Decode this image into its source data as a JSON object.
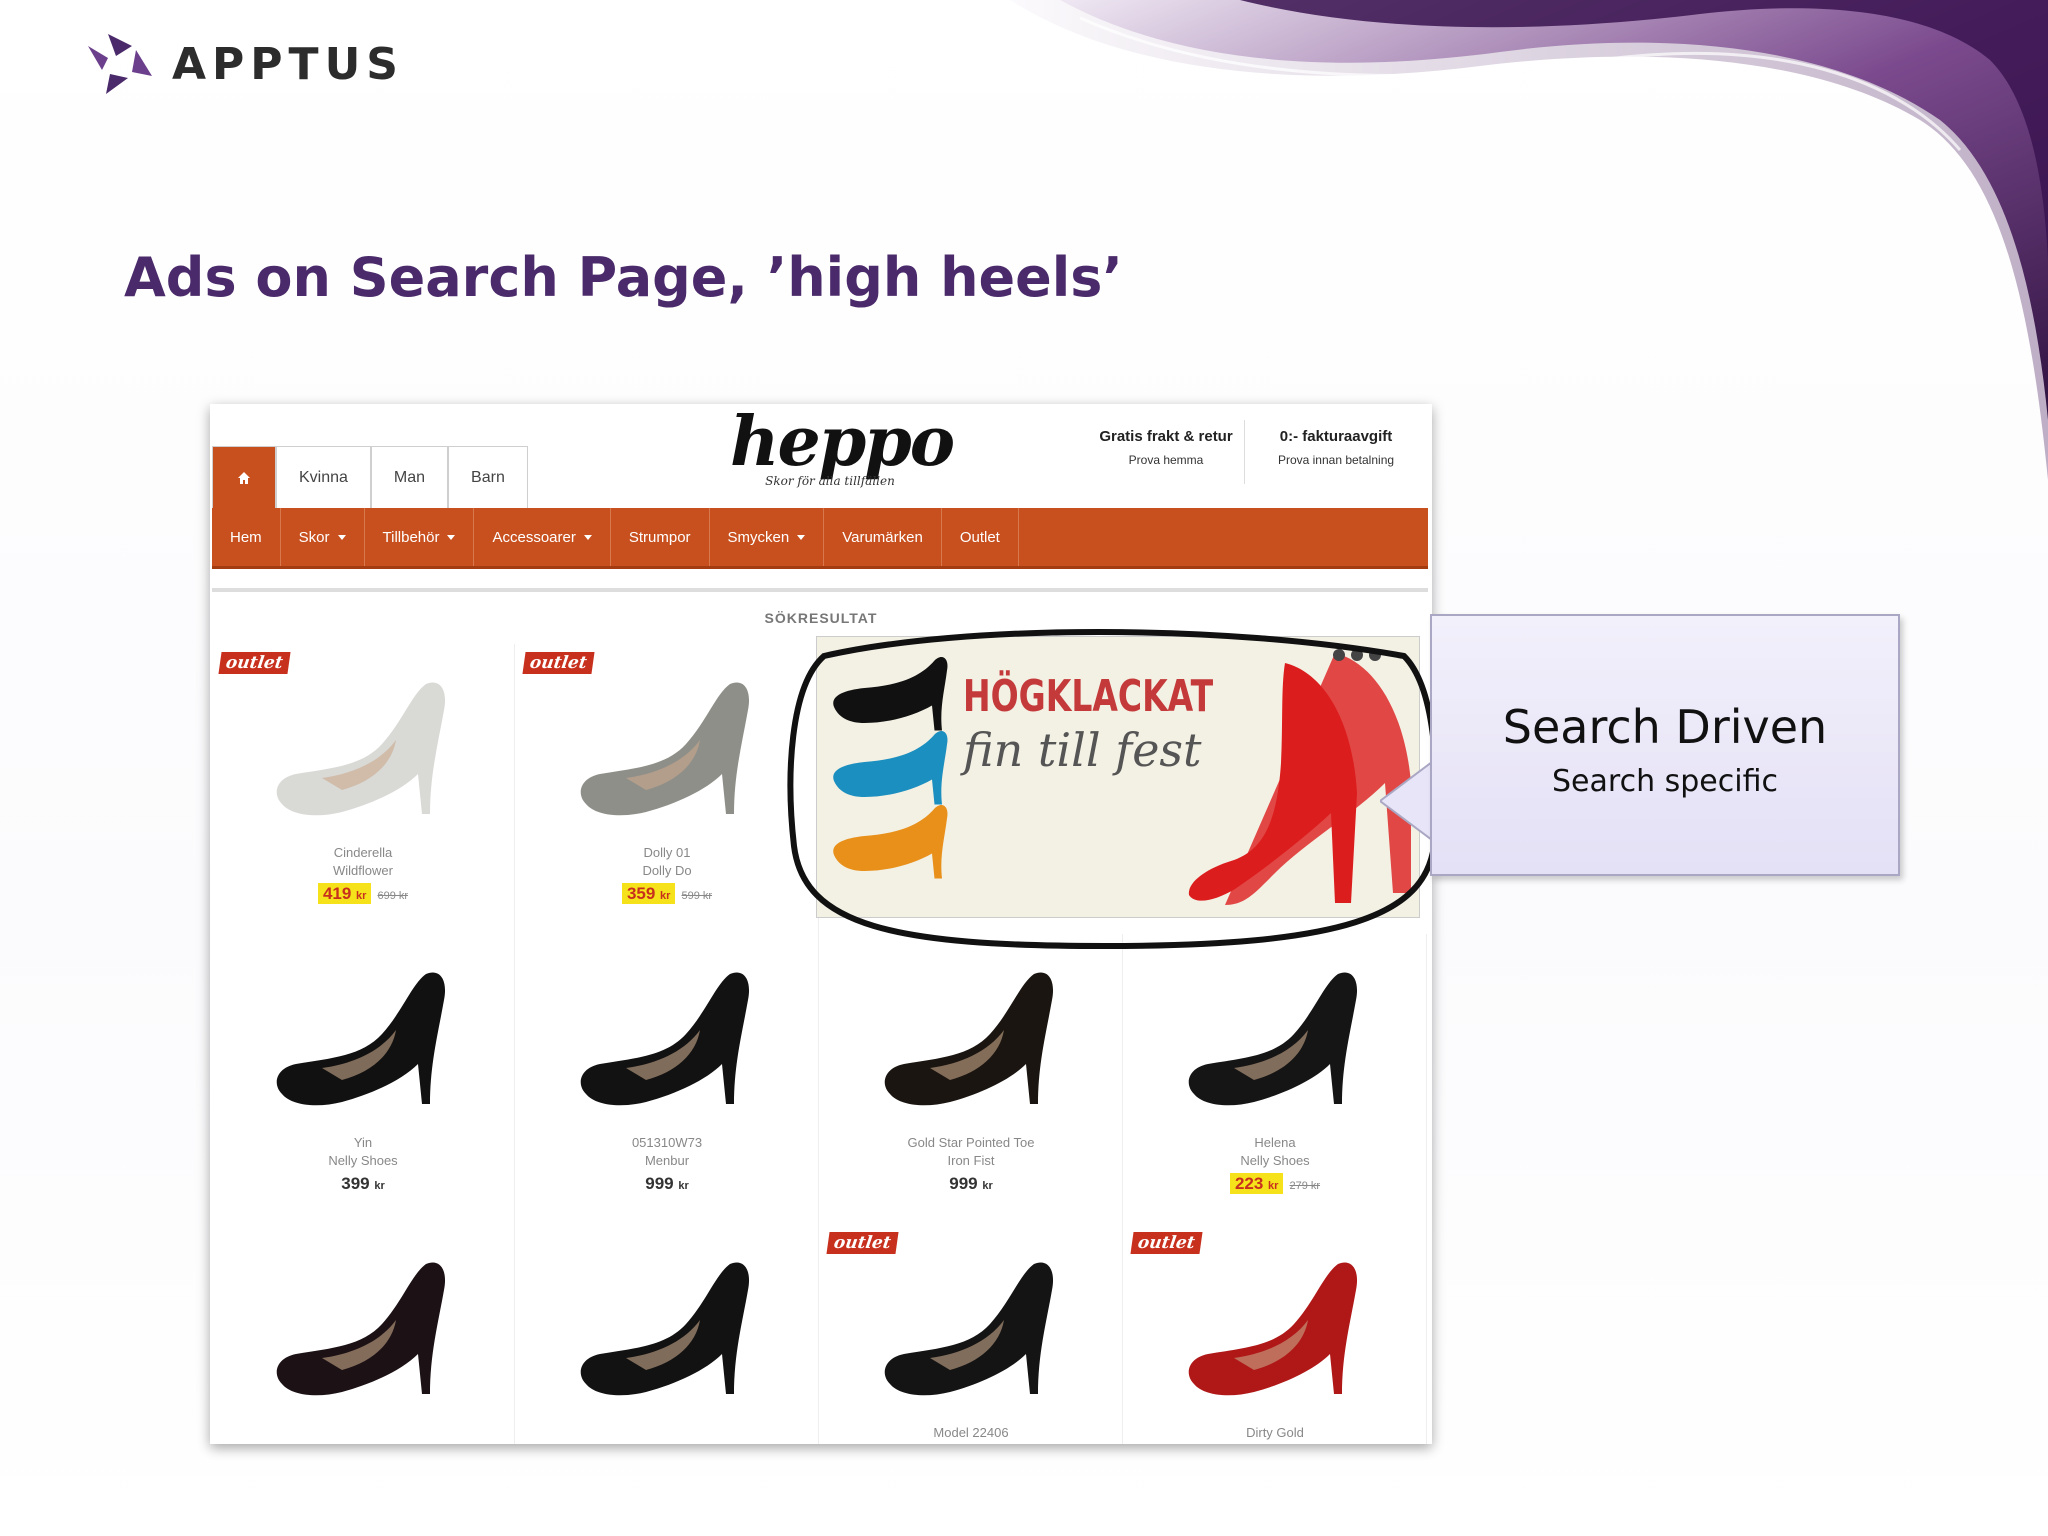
{
  "colors": {
    "title": "#4a2a6a",
    "brand_orange": "#c8501e",
    "price_highlight": "#f6e21a",
    "outlet_red": "#c8301e",
    "callout_bg": "#e8e5f8"
  },
  "logo": {
    "text": "APPTUS",
    "icon": "apptus-triangle-logo"
  },
  "slide": {
    "title": "Ads on Search Page, ’high heels’"
  },
  "store": {
    "brand": "heppo",
    "tagline": "Skor för alla tillfällen",
    "home_icon": "home-icon",
    "top_tabs": [
      "Kvinna",
      "Man",
      "Barn"
    ],
    "promos": [
      {
        "title": "Gratis frakt & retur",
        "sub": "Prova hemma"
      },
      {
        "title": "0:- fakturaavgift",
        "sub": "Prova innan betalning"
      }
    ],
    "nav": [
      {
        "label": "Hem",
        "caret": false
      },
      {
        "label": "Skor",
        "caret": true
      },
      {
        "label": "Tillbehör",
        "caret": true
      },
      {
        "label": "Accessoarer",
        "caret": true
      },
      {
        "label": "Strumpor",
        "caret": false
      },
      {
        "label": "Smycken",
        "caret": true
      },
      {
        "label": "Varumärken",
        "caret": false
      },
      {
        "label": "Outlet",
        "caret": false
      }
    ],
    "results_label": "SÖKRESULTAT",
    "outlet_badge": "outlet",
    "currency": "kr",
    "products": [
      {
        "name": "Cinderella",
        "brand": "Wildflower",
        "price": "419",
        "old_price": "699 kr",
        "outlet": true,
        "highlight": true,
        "shoe_color": "#d9d9d6"
      },
      {
        "name": "Dolly 01",
        "brand": "Dolly Do",
        "price": "359",
        "old_price": "599 kr",
        "outlet": true,
        "highlight": true,
        "shoe_color": "#8f8f8a"
      },
      {
        "name": "Yin",
        "brand": "Nelly Shoes",
        "price": "399",
        "old_price": "",
        "outlet": false,
        "highlight": false,
        "shoe_color": "#111111"
      },
      {
        "name": "051310W73",
        "brand": "Menbur",
        "price": "999",
        "old_price": "",
        "outlet": false,
        "highlight": false,
        "shoe_color": "#121212"
      },
      {
        "name": "Gold Star Pointed Toe",
        "brand": "Iron Fist",
        "price": "999",
        "old_price": "",
        "outlet": false,
        "highlight": false,
        "shoe_color": "#1a1510"
      },
      {
        "name": "Helena",
        "brand": "Nelly Shoes",
        "price": "223",
        "old_price": "279 kr",
        "outlet": false,
        "highlight": true,
        "shoe_color": "#151515"
      },
      {
        "name": "",
        "brand": "",
        "price": "",
        "old_price": "",
        "outlet": false,
        "highlight": false,
        "shoe_color": "#1c1216"
      },
      {
        "name": "",
        "brand": "",
        "price": "",
        "old_price": "",
        "outlet": false,
        "highlight": false,
        "shoe_color": "#121212"
      },
      {
        "name": "Model 22406",
        "brand": "",
        "price": "",
        "old_price": "",
        "outlet": true,
        "highlight": false,
        "shoe_color": "#141414"
      },
      {
        "name": "Dirty Gold",
        "brand": "",
        "price": "",
        "old_price": "",
        "outlet": true,
        "highlight": false,
        "shoe_color": "#b01818"
      }
    ],
    "ad": {
      "headline": "HÖGKLACKAT",
      "subline": "fin till fest",
      "shoe_colors": [
        "#111111",
        "#1b8fbf",
        "#e8901a"
      ],
      "hero_color": "#dc1d1d"
    }
  },
  "callout": {
    "title": "Search Driven",
    "subtitle": "Search specific"
  }
}
